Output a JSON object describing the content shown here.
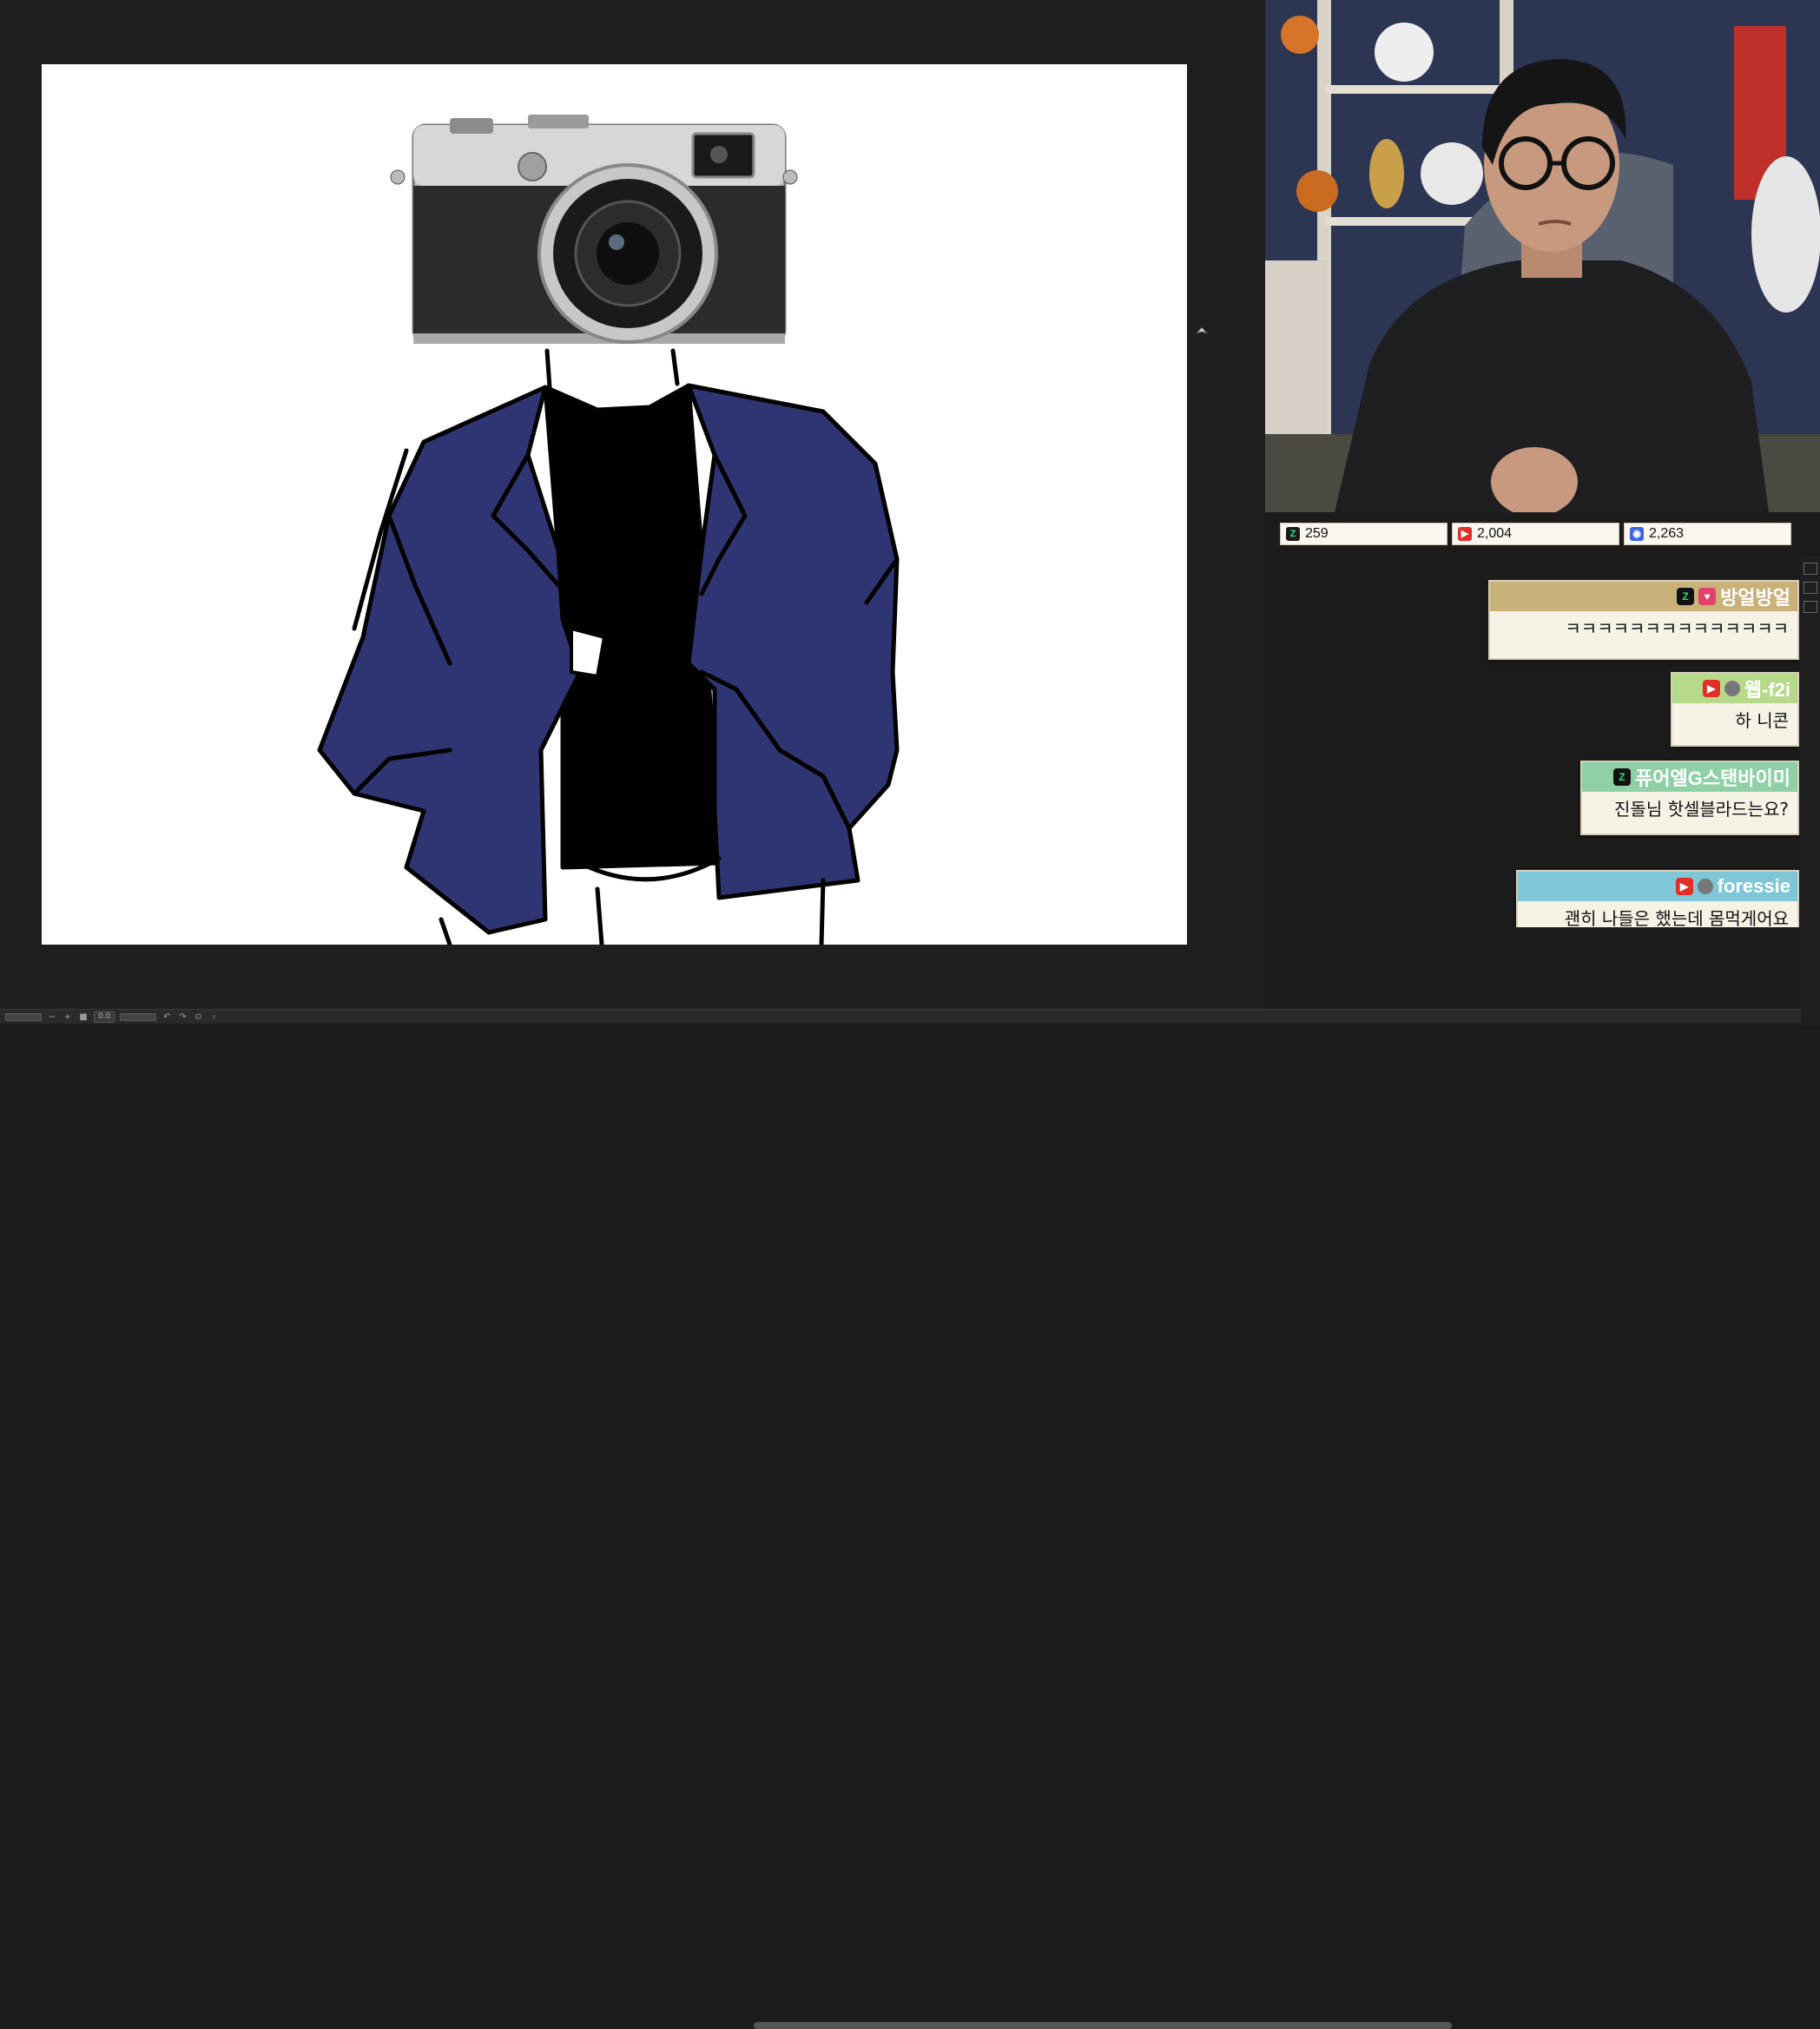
{
  "statusbar": {
    "zoom_value": "0.0"
  },
  "counters": [
    {
      "platform_icon": "chzzk-icon",
      "value": "259"
    },
    {
      "platform_icon": "youtube-icon",
      "value": "2,004"
    },
    {
      "platform_icon": "soop-icon",
      "value": "2,263"
    }
  ],
  "chat": [
    {
      "platform_icon": "chzzk-icon",
      "username": "방얼방얼",
      "text": "ㅋㅋㅋㅋㅋㅋㅋㅋㅋㅋㅋㅋㅋㅋ",
      "header_color": "#c9b27a"
    },
    {
      "platform_icon": "youtube-icon",
      "username": "웹-f2i",
      "text": "하 니콘",
      "header_color": "#b7d98a"
    },
    {
      "platform_icon": "chzzk-icon",
      "username": "퓨어엘G스탠바이미",
      "text": "진돌님 핫셀블라드는요?",
      "header_color": "#8fd0a6"
    },
    {
      "platform_icon": "youtube-icon",
      "username": "foressie",
      "text": "괜히 나들은 했는데 몸먹게어요",
      "header_color": "#7ec6d8"
    }
  ],
  "colors": {
    "jacket": "#2f3572",
    "canvas_bg": "#ffffff",
    "workspace_bg": "#1e1e1e"
  }
}
